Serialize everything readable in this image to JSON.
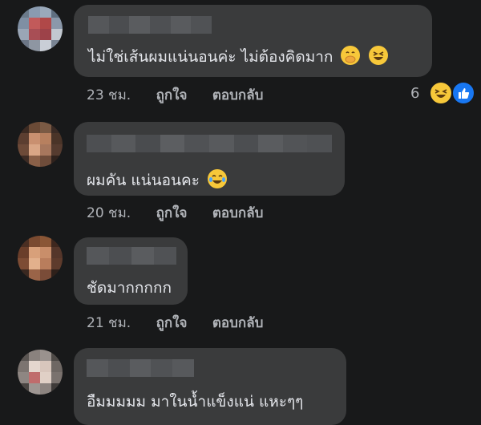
{
  "comments": [
    {
      "text": "ไม่ใช่เส้นผมแน่นอนค่ะ ไม่ต้องคิดมาก",
      "emojis": [
        "hand-over-mouth-icon",
        "grinning-squinting-icon"
      ],
      "time": "23 ชม.",
      "like_label": "ถูกใจ",
      "reply_label": "ตอบกลับ",
      "reaction_count": "6",
      "reactions": [
        "haha-reaction-icon",
        "like-reaction-icon"
      ]
    },
    {
      "text": "ผมคัน แน่นอนคะ",
      "emojis": [
        "tears-of-joy-icon"
      ],
      "time": "20 ชม.",
      "like_label": "ถูกใจ",
      "reply_label": "ตอบกลับ"
    },
    {
      "text": "ชัดมากกกกก",
      "time": "21 ชม.",
      "like_label": "ถูกใจ",
      "reply_label": "ตอบกลับ"
    },
    {
      "text": "อืมมมมม มาในน้ำแข็งแน่ แหะๆๆ"
    }
  ],
  "colors": {
    "background": "#18191a",
    "bubble": "#3a3b3c",
    "text": "#e4e6eb",
    "meta": "#b0b3b8",
    "like_blue": "#1877f2",
    "emoji_yellow": "#f7c83a"
  }
}
